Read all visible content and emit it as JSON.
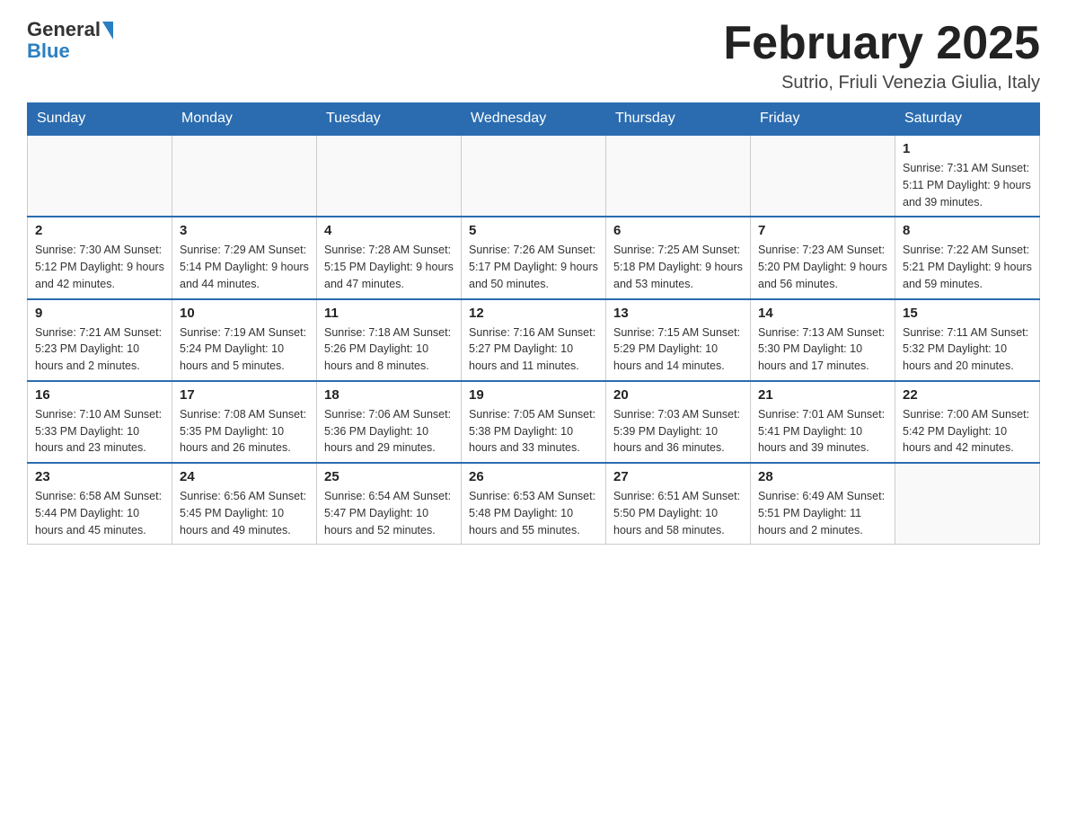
{
  "header": {
    "logo_general": "General",
    "logo_blue": "Blue",
    "month_title": "February 2025",
    "location": "Sutrio, Friuli Venezia Giulia, Italy"
  },
  "days_of_week": [
    "Sunday",
    "Monday",
    "Tuesday",
    "Wednesday",
    "Thursday",
    "Friday",
    "Saturday"
  ],
  "weeks": [
    {
      "days": [
        {
          "date": "",
          "info": ""
        },
        {
          "date": "",
          "info": ""
        },
        {
          "date": "",
          "info": ""
        },
        {
          "date": "",
          "info": ""
        },
        {
          "date": "",
          "info": ""
        },
        {
          "date": "",
          "info": ""
        },
        {
          "date": "1",
          "info": "Sunrise: 7:31 AM\nSunset: 5:11 PM\nDaylight: 9 hours and 39 minutes."
        }
      ]
    },
    {
      "days": [
        {
          "date": "2",
          "info": "Sunrise: 7:30 AM\nSunset: 5:12 PM\nDaylight: 9 hours and 42 minutes."
        },
        {
          "date": "3",
          "info": "Sunrise: 7:29 AM\nSunset: 5:14 PM\nDaylight: 9 hours and 44 minutes."
        },
        {
          "date": "4",
          "info": "Sunrise: 7:28 AM\nSunset: 5:15 PM\nDaylight: 9 hours and 47 minutes."
        },
        {
          "date": "5",
          "info": "Sunrise: 7:26 AM\nSunset: 5:17 PM\nDaylight: 9 hours and 50 minutes."
        },
        {
          "date": "6",
          "info": "Sunrise: 7:25 AM\nSunset: 5:18 PM\nDaylight: 9 hours and 53 minutes."
        },
        {
          "date": "7",
          "info": "Sunrise: 7:23 AM\nSunset: 5:20 PM\nDaylight: 9 hours and 56 minutes."
        },
        {
          "date": "8",
          "info": "Sunrise: 7:22 AM\nSunset: 5:21 PM\nDaylight: 9 hours and 59 minutes."
        }
      ]
    },
    {
      "days": [
        {
          "date": "9",
          "info": "Sunrise: 7:21 AM\nSunset: 5:23 PM\nDaylight: 10 hours and 2 minutes."
        },
        {
          "date": "10",
          "info": "Sunrise: 7:19 AM\nSunset: 5:24 PM\nDaylight: 10 hours and 5 minutes."
        },
        {
          "date": "11",
          "info": "Sunrise: 7:18 AM\nSunset: 5:26 PM\nDaylight: 10 hours and 8 minutes."
        },
        {
          "date": "12",
          "info": "Sunrise: 7:16 AM\nSunset: 5:27 PM\nDaylight: 10 hours and 11 minutes."
        },
        {
          "date": "13",
          "info": "Sunrise: 7:15 AM\nSunset: 5:29 PM\nDaylight: 10 hours and 14 minutes."
        },
        {
          "date": "14",
          "info": "Sunrise: 7:13 AM\nSunset: 5:30 PM\nDaylight: 10 hours and 17 minutes."
        },
        {
          "date": "15",
          "info": "Sunrise: 7:11 AM\nSunset: 5:32 PM\nDaylight: 10 hours and 20 minutes."
        }
      ]
    },
    {
      "days": [
        {
          "date": "16",
          "info": "Sunrise: 7:10 AM\nSunset: 5:33 PM\nDaylight: 10 hours and 23 minutes."
        },
        {
          "date": "17",
          "info": "Sunrise: 7:08 AM\nSunset: 5:35 PM\nDaylight: 10 hours and 26 minutes."
        },
        {
          "date": "18",
          "info": "Sunrise: 7:06 AM\nSunset: 5:36 PM\nDaylight: 10 hours and 29 minutes."
        },
        {
          "date": "19",
          "info": "Sunrise: 7:05 AM\nSunset: 5:38 PM\nDaylight: 10 hours and 33 minutes."
        },
        {
          "date": "20",
          "info": "Sunrise: 7:03 AM\nSunset: 5:39 PM\nDaylight: 10 hours and 36 minutes."
        },
        {
          "date": "21",
          "info": "Sunrise: 7:01 AM\nSunset: 5:41 PM\nDaylight: 10 hours and 39 minutes."
        },
        {
          "date": "22",
          "info": "Sunrise: 7:00 AM\nSunset: 5:42 PM\nDaylight: 10 hours and 42 minutes."
        }
      ]
    },
    {
      "days": [
        {
          "date": "23",
          "info": "Sunrise: 6:58 AM\nSunset: 5:44 PM\nDaylight: 10 hours and 45 minutes."
        },
        {
          "date": "24",
          "info": "Sunrise: 6:56 AM\nSunset: 5:45 PM\nDaylight: 10 hours and 49 minutes."
        },
        {
          "date": "25",
          "info": "Sunrise: 6:54 AM\nSunset: 5:47 PM\nDaylight: 10 hours and 52 minutes."
        },
        {
          "date": "26",
          "info": "Sunrise: 6:53 AM\nSunset: 5:48 PM\nDaylight: 10 hours and 55 minutes."
        },
        {
          "date": "27",
          "info": "Sunrise: 6:51 AM\nSunset: 5:50 PM\nDaylight: 10 hours and 58 minutes."
        },
        {
          "date": "28",
          "info": "Sunrise: 6:49 AM\nSunset: 5:51 PM\nDaylight: 11 hours and 2 minutes."
        },
        {
          "date": "",
          "info": ""
        }
      ]
    }
  ]
}
